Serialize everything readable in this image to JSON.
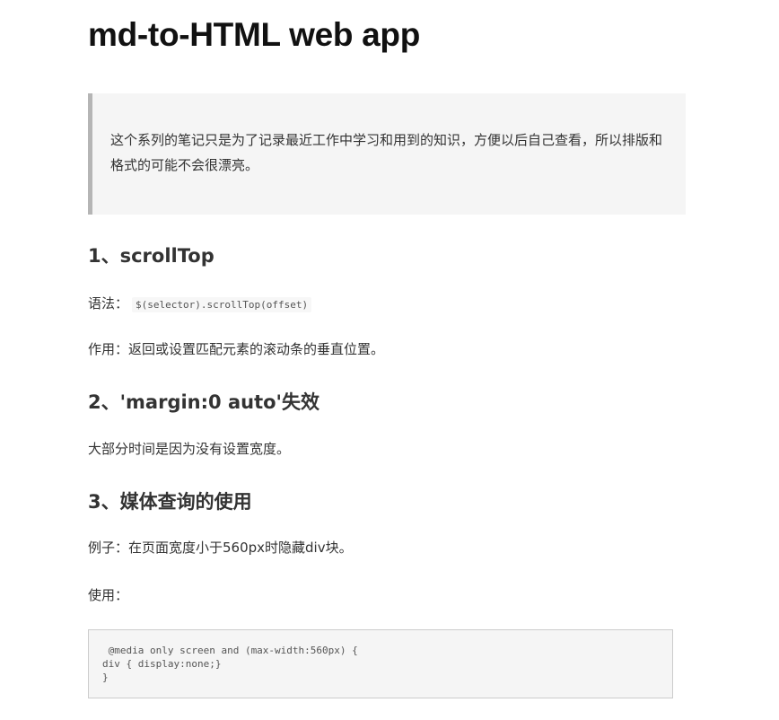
{
  "title": "md-to-HTML web app",
  "intro_quote": "这个系列的笔记只是为了记录最近工作中学习和用到的知识，方便以后自己查看，所以排版和格式的可能不会很漂亮。",
  "sections": [
    {
      "heading": "1、scrollTop",
      "syntax_label": "语法：",
      "syntax_code": "$(selector).scrollTop(offset)",
      "usage": "作用：返回或设置匹配元素的滚动条的垂直位置。"
    },
    {
      "heading": "2、'margin:0 auto'失效",
      "text": "大部分时间是因为没有设置宽度。"
    },
    {
      "heading": "3、媒体查询的使用",
      "example": "例子：在页面宽度小于560px时隐藏div块。",
      "usage_label": "使用：",
      "code_block": " @media only screen and (max-width:560px) {\ndiv { display:none;}\n}"
    }
  ]
}
